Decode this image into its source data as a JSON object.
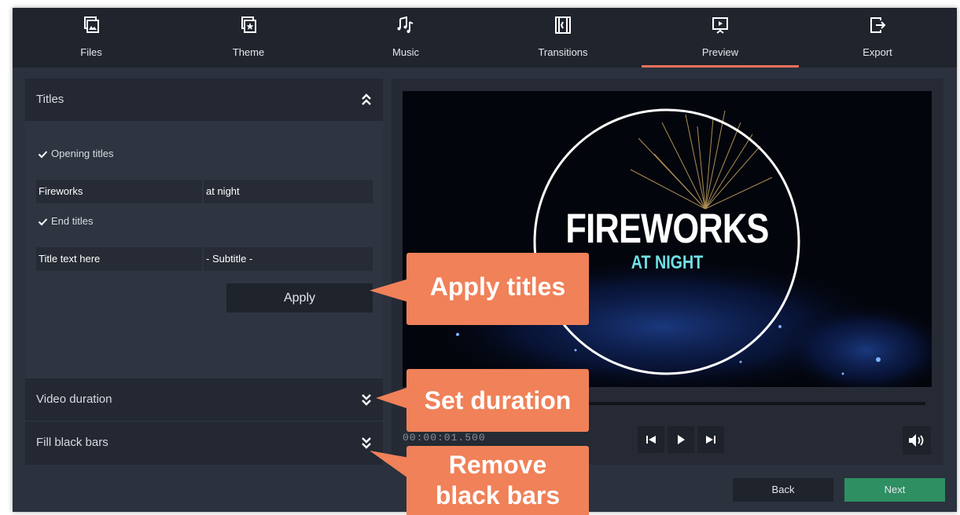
{
  "nav": {
    "tabs": [
      {
        "label": "Files",
        "icon": "files-icon"
      },
      {
        "label": "Theme",
        "icon": "theme-icon"
      },
      {
        "label": "Music",
        "icon": "music-icon"
      },
      {
        "label": "Transitions",
        "icon": "transitions-icon"
      },
      {
        "label": "Preview",
        "icon": "preview-icon",
        "active": true
      },
      {
        "label": "Export",
        "icon": "export-icon"
      }
    ],
    "accent_color": "#e8715a"
  },
  "titles_panel": {
    "header": "Titles",
    "opening_checkbox_label": "Opening titles",
    "opening_checked": true,
    "opening_title": "Fireworks",
    "opening_subtitle": "at night",
    "end_checkbox_label": "End titles",
    "end_checked": true,
    "end_title_placeholder": "Title text here",
    "end_subtitle_placeholder": "- Subtitle -",
    "apply_label": "Apply"
  },
  "duration_section": {
    "header": "Video duration"
  },
  "blackbars_section": {
    "header": "Fill black bars"
  },
  "preview": {
    "title_main": "FIREWORKS",
    "title_sub": "AT NIGHT",
    "timecode": "00:00:01.500",
    "subtitle_color": "#6fe1e6"
  },
  "footer": {
    "back_label": "Back",
    "next_label": "Next",
    "next_color": "#2e8f63"
  },
  "callouts": {
    "apply": "Apply titles",
    "duration": "Set duration",
    "remove_line1": "Remove",
    "remove_line2": "black bars",
    "color": "#f08159"
  }
}
